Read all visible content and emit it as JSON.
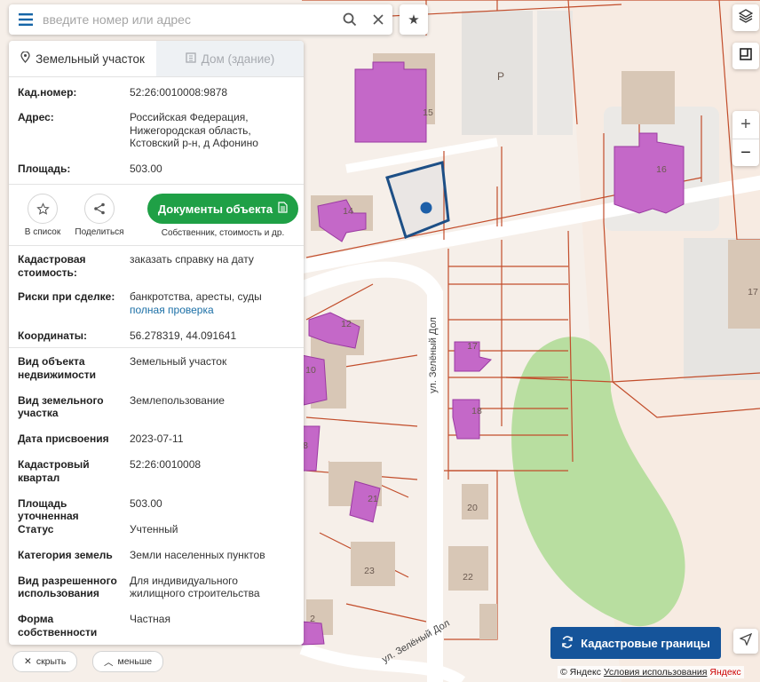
{
  "search": {
    "placeholder": "введите номер или адрес"
  },
  "tabs": [
    {
      "label": "Земельный участок",
      "active": true
    },
    {
      "label": "Дом (здание)",
      "active": false
    }
  ],
  "parcel": {
    "cad_label": "Кад.номер:",
    "cad_value": "52:26:0010008:9878",
    "addr_label": "Адрес:",
    "addr_lines": [
      "Российская Федерация,",
      "Нижегородская область,",
      "Кстовский р-н, д Афонино"
    ],
    "area_label": "Площадь:",
    "area_value": "503.00"
  },
  "actions": {
    "save_label": "В список",
    "share_label": "Поделиться",
    "docs_label": "Документы объекта",
    "docs_sub": "Собственник, стоимость и др."
  },
  "details": {
    "cost_label_1": "Кадастровая",
    "cost_label_2": "стоимость:",
    "cost_link": "заказать справку на дату",
    "risk_label": "Риски при сделке:",
    "risk_text": "банкротства, аресты, суды",
    "risk_link": "полная проверка",
    "coords_label": "Координаты:",
    "coords_value": "56.278319, 44.091641"
  },
  "props": [
    {
      "label": [
        "Вид объекта",
        "недвижимости"
      ],
      "value": [
        "Земельный участок"
      ]
    },
    {
      "label": [
        "Вид земельного",
        "участка"
      ],
      "value": [
        "Землепользование"
      ]
    },
    {
      "label": [
        "Дата присвоения"
      ],
      "value": [
        "2023-07-11"
      ]
    },
    {
      "label": [
        "Кадастровый",
        "квартал"
      ],
      "value": [
        "52:26:0010008"
      ]
    },
    {
      "label": [
        "Площадь уточненная"
      ],
      "value": [
        "503.00"
      ]
    },
    {
      "label": [
        "Статус"
      ],
      "value": [
        "Учтенный"
      ]
    },
    {
      "label": [
        "Категория земель"
      ],
      "value": [
        "Земли населенных пунктов"
      ]
    },
    {
      "label": [
        "Вид разрешенного",
        "использования"
      ],
      "value": [
        "Для индивидуального",
        "жилищного строительства"
      ]
    },
    {
      "label": [
        "Форма",
        "собственности"
      ],
      "value": [
        "Частная"
      ]
    }
  ],
  "bottom": {
    "hide_label": "скрыть",
    "less_label": "меньше"
  },
  "map": {
    "street_1": "ул. Зелёный Дол",
    "street_2": "ул. Зелёный Дол",
    "parking": "P",
    "house_numbers": [
      "15",
      "16",
      "14",
      "12",
      "10",
      "8",
      "17",
      "18",
      "21",
      "23",
      "20",
      "22",
      "2",
      "17"
    ],
    "kad_button": "Кадастровые границы",
    "attribution_logo": "© Яндекс",
    "attribution_link": "Условия использования",
    "attribution_trail": "Яндекс",
    "zoom_in": "+",
    "zoom_out": "−",
    "colors": {
      "building": "#c468c8",
      "road": "#ffffff",
      "plot_line": "#c24d2b",
      "green": "#b8dea0",
      "selected": "#1d4f86",
      "accent": "#15549a"
    }
  }
}
